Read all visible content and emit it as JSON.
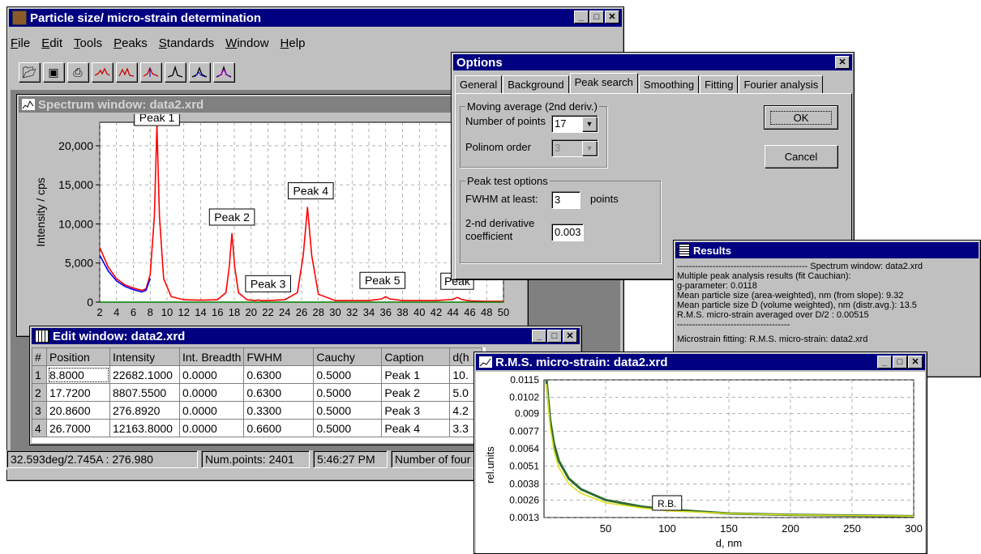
{
  "main": {
    "title": "Particle size/ micro-strain determination",
    "menu": [
      "File",
      "Edit",
      "Tools",
      "Peaks",
      "Standards",
      "Window",
      "Help"
    ],
    "toolbar_icons": [
      "open-icon",
      "save-icon",
      "print-icon",
      "peak-search-icon",
      "smooth-icon",
      "fit-icon",
      "peak-shape-icon",
      "peak-compare-icon",
      "peak-fourier-icon"
    ]
  },
  "spectrum": {
    "title": "Spectrum window: data2.xrd",
    "ylabel": "Intensity / cps"
  },
  "chart_data": [
    {
      "type": "line",
      "title": "Spectrum window: data2.xrd",
      "xlabel": "",
      "ylabel": "Intensity / cps",
      "xlim": [
        2,
        50
      ],
      "ylim": [
        0,
        23000
      ],
      "x_ticks": [
        2,
        4,
        6,
        8,
        10,
        12,
        14,
        16,
        18,
        20,
        22,
        24,
        26,
        28,
        30,
        32,
        34,
        36,
        38,
        40,
        42,
        44,
        46,
        48,
        50
      ],
      "y_ticks": [
        0,
        5000,
        10000,
        15000,
        20000
      ],
      "y_tick_labels": [
        "0",
        "5,000",
        "10,000",
        "15,000",
        "20,000"
      ],
      "grid": true,
      "peaks": [
        {
          "label": "Peak 1",
          "x": 8.8,
          "y": 22682
        },
        {
          "label": "Peak 2",
          "x": 17.72,
          "y": 8807
        },
        {
          "label": "Peak 3",
          "x": 20.86,
          "y": 277
        },
        {
          "label": "Peak 4",
          "x": 26.7,
          "y": 12164
        },
        {
          "label": "Peak 5",
          "x": 36.0,
          "y": 700
        },
        {
          "label": "Peak",
          "x": 44.5,
          "y": 600
        }
      ],
      "series": [
        {
          "color": "#ff0000",
          "x": [
            2,
            3,
            4,
            5,
            6,
            7,
            7.5,
            8,
            8.5,
            8.8,
            9.1,
            9.6,
            10.5,
            12,
            14,
            16,
            17,
            17.4,
            17.72,
            18.05,
            18.5,
            19.5,
            20.5,
            20.86,
            21.2,
            22,
            24,
            25.5,
            26.2,
            26.7,
            27.2,
            28,
            30,
            34,
            35.5,
            36,
            36.5,
            38,
            42,
            44,
            44.5,
            45,
            46,
            48,
            50
          ],
          "y": [
            7000,
            4500,
            3000,
            2200,
            1800,
            1500,
            1700,
            3500,
            11000,
            22682,
            11000,
            3000,
            700,
            300,
            250,
            300,
            1200,
            4500,
            8807,
            4500,
            1200,
            300,
            200,
            277,
            200,
            200,
            300,
            1200,
            6000,
            12164,
            6000,
            1000,
            200,
            200,
            400,
            700,
            400,
            200,
            200,
            350,
            600,
            350,
            150,
            100,
            100
          ]
        },
        {
          "color": "#0000ff",
          "x": [
            2,
            3,
            4,
            5,
            6,
            7,
            7.5,
            8
          ],
          "y": [
            6000,
            4000,
            2700,
            2000,
            1600,
            1300,
            1500,
            3000
          ]
        },
        {
          "color": "#008000",
          "x": [
            2,
            10,
            20,
            30,
            40,
            50
          ],
          "y": [
            0,
            0,
            0,
            0,
            0,
            0
          ]
        }
      ]
    },
    {
      "type": "line",
      "title": "R.M.S. micro-strain: data2.xrd",
      "xlabel": "d, nm",
      "ylabel": "rel.units",
      "xlim": [
        0,
        300
      ],
      "ylim": [
        0.0013,
        0.0115
      ],
      "x_ticks": [
        50,
        100,
        150,
        200,
        250,
        300
      ],
      "y_ticks": [
        0.0013,
        0.0026,
        0.0038,
        0.0051,
        0.0064,
        0.0077,
        0.009,
        0.0102,
        0.0115
      ],
      "grid": true,
      "annotations": [
        "R.B."
      ],
      "series": [
        {
          "color": "#2f6b2f",
          "x": [
            2,
            5,
            8,
            12,
            20,
            30,
            50,
            80,
            100,
            150,
            200,
            250,
            300
          ],
          "y": [
            0.0115,
            0.0085,
            0.0068,
            0.0055,
            0.0042,
            0.0034,
            0.0026,
            0.0021,
            0.0019,
            0.0016,
            0.0015,
            0.00145,
            0.0014
          ]
        },
        {
          "color": "#e0e020",
          "x": [
            2,
            5,
            8,
            12,
            20,
            30,
            50,
            80,
            100,
            150,
            200,
            250,
            300
          ],
          "y": [
            0.0112,
            0.008,
            0.0063,
            0.005,
            0.0038,
            0.0031,
            0.0024,
            0.002,
            0.0018,
            0.0016,
            0.0015,
            0.00145,
            0.0014
          ]
        }
      ]
    }
  ],
  "edit": {
    "title": "Edit window: data2.xrd",
    "columns": [
      "#",
      "Position",
      "Intensity",
      "Int. Breadth",
      "FWHM",
      "Cauchy",
      "Caption",
      "d(h"
    ],
    "rows": [
      [
        "1",
        "8.8000",
        "22682.1000",
        "0.0000",
        "0.6300",
        "0.5000",
        "Peak 1",
        "10."
      ],
      [
        "2",
        "17.7200",
        "8807.5500",
        "0.0000",
        "0.6300",
        "0.5000",
        "Peak 2",
        "5.0"
      ],
      [
        "3",
        "20.8600",
        "276.8920",
        "0.0000",
        "0.3300",
        "0.5000",
        "Peak 3",
        "4.2"
      ],
      [
        "4",
        "26.7000",
        "12163.8000",
        "0.0000",
        "0.6600",
        "0.5000",
        "Peak 4",
        "3.3"
      ]
    ]
  },
  "status": [
    "32.593deg/2.745A : 276.980",
    "Num.points: 2401",
    "5:46:27 PM",
    "Number of four"
  ],
  "options": {
    "title": "Options",
    "tabs": [
      "General",
      "Background",
      "Peak search",
      "Smoothing",
      "Fitting",
      "Fourier analysis"
    ],
    "selected_tab": "Peak search",
    "moving_avg_group": "Moving average (2nd deriv.)",
    "num_points_label": "Number of points",
    "num_points_value": "17",
    "polinom_label": "Polinom order",
    "polinom_value": "3",
    "peak_test_group": "Peak test options",
    "fwhm_label": "FWHM at least:",
    "fwhm_value": "3",
    "fwhm_unit": "points",
    "deriv_label_1": "2-nd derivative",
    "deriv_label_2": "coefficient",
    "deriv_value": "0.003",
    "ok": "OK",
    "cancel": "Cancel"
  },
  "results": {
    "title": "Results",
    "lines": [
      "-------------------------------------------- Spectrum window: data2.xrd",
      "Multiple peak analysis results (fit Cauchian):",
      "g-parameter: 0.0118",
      "Mean particle size (area-weighted), nm (from slope): 9.32",
      "Mean particle size D (volume weighted), nm (distr.avg.): 13.5",
      "R.M.S. micro-strain averaged over D/2 : 0.00515",
      "--------------------------------------",
      "Microstrain fitting: R.M.S. micro-strain: data2.xrd"
    ]
  },
  "rms": {
    "title": "R.M.S. micro-strain: data2.xrd",
    "xlabel": "d, nm",
    "ylabel": "rel.units"
  }
}
